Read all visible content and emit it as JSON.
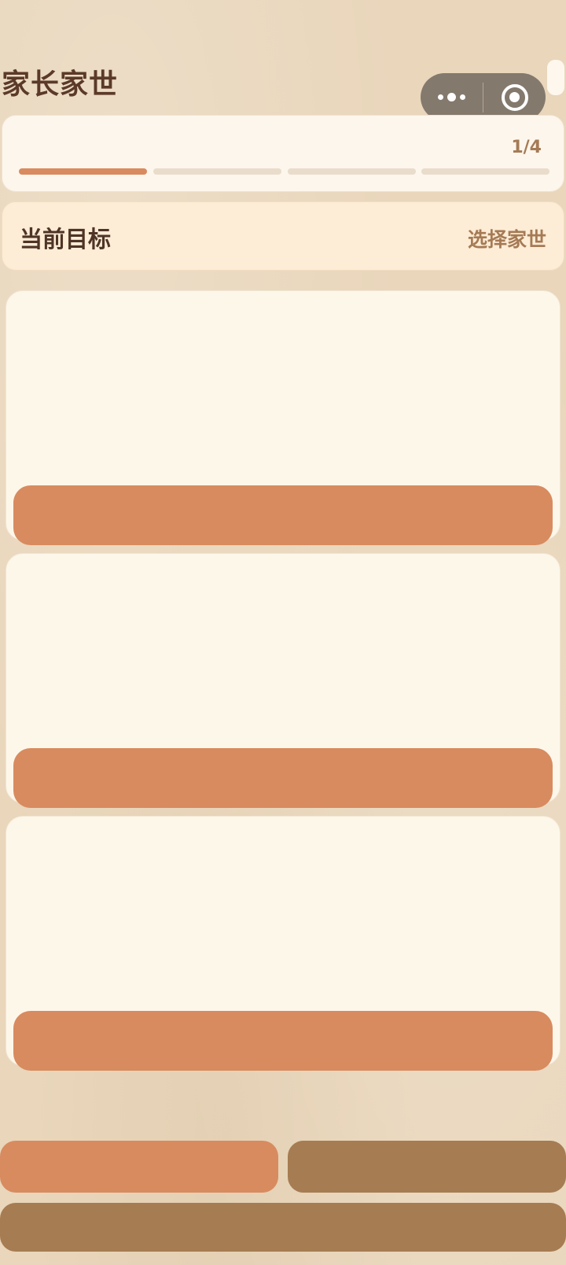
{
  "header": {
    "title": "家长家世"
  },
  "progress": {
    "count_label": "1/4",
    "current_step": 1,
    "total_steps": 4
  },
  "goal": {
    "label": "当前目标",
    "action": "选择家世"
  },
  "options": [
    {
      "id": "option-1"
    },
    {
      "id": "option-2"
    },
    {
      "id": "option-3"
    }
  ],
  "colors": {
    "background": "#e9d6bb",
    "accent": "#d88b5f",
    "secondary": "#a67c52",
    "title_text": "#5b3a29",
    "muted_text": "#a57a55"
  },
  "icons": {
    "capsule_more": "more-dots-icon",
    "capsule_close": "target-circle-icon"
  }
}
